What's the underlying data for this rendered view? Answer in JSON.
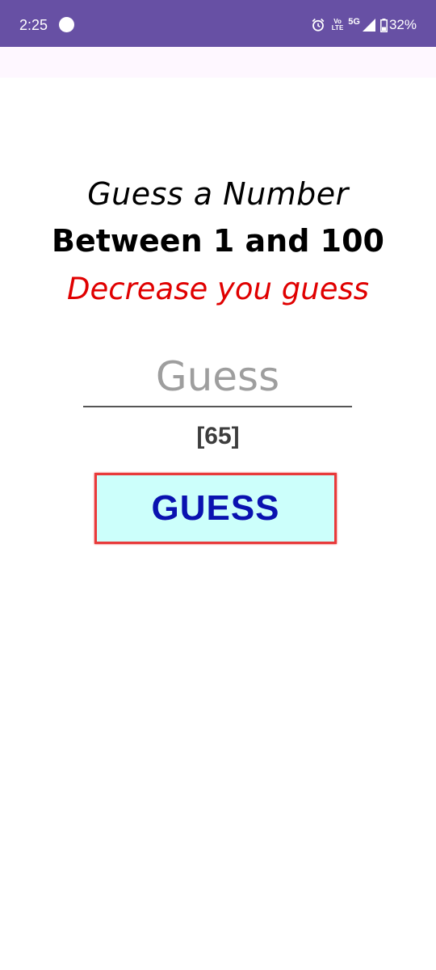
{
  "status_bar": {
    "time": "2:25",
    "volte_top": "Vo",
    "volte_bottom": "LTE",
    "network": "5G",
    "battery": "32%"
  },
  "game": {
    "title_line1": "Guess a Number",
    "title_line2": "Between 1 and 100",
    "hint": "Decrease you guess",
    "input": {
      "placeholder": "Guess",
      "value": ""
    },
    "previous_guesses": "[65]",
    "button_label": "GUESS"
  },
  "colors": {
    "status_bar": "#6750a4",
    "hint": "#e00000",
    "button_bg": "#ccfffb",
    "button_border": "#e83a3a",
    "button_text": "#0a12b0"
  },
  "icons": [
    "alarm-icon",
    "signal-icon",
    "battery-icon"
  ]
}
